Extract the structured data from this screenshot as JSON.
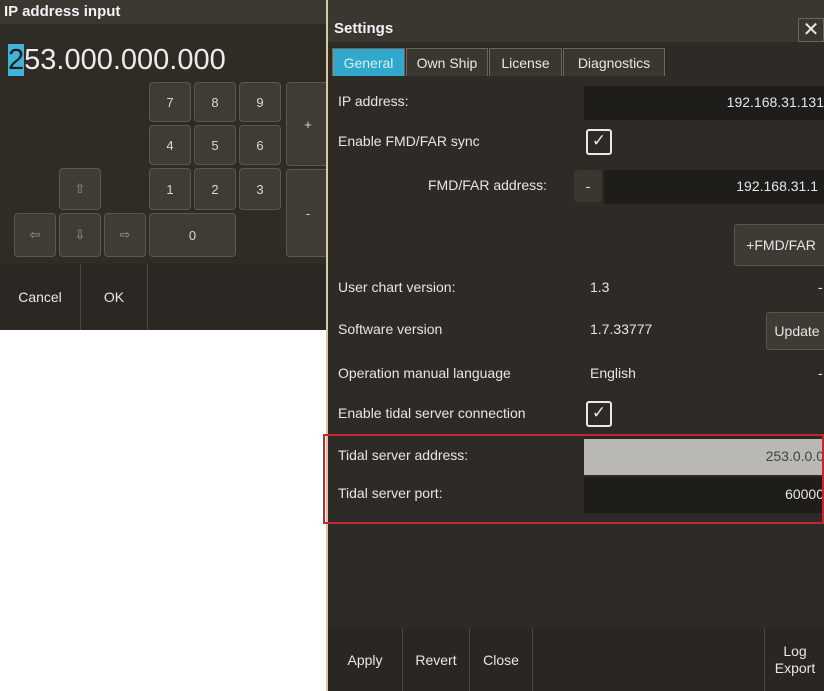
{
  "ip_dialog": {
    "title": "IP address input",
    "value_cursor": "2",
    "value_rest": "53.000.000.000",
    "keys": {
      "k7": "7",
      "k8": "8",
      "k9": "9",
      "k4": "4",
      "k5": "5",
      "k6": "6",
      "k1": "1",
      "k2": "2",
      "k3": "3",
      "k0": "0",
      "plus": "+",
      "minus": "-"
    },
    "arrows": {
      "up": "⇧",
      "down": "⇩",
      "left": "⇦",
      "right": "⇨"
    },
    "cancel_label": "Cancel",
    "ok_label": "OK"
  },
  "settings": {
    "title": "Settings",
    "close_glyph": "✕",
    "tabs": [
      "General",
      "Own Ship",
      "License",
      "Diagnostics"
    ],
    "active_tab": "General",
    "ip_address_label": "IP address:",
    "ip_address_value": "192.168.31.131",
    "fmd_sync_label": "Enable FMD/FAR sync",
    "fmd_sync_checked": "☑",
    "fmd_address_label": "FMD/FAR address:",
    "fmd_address_minus": "-",
    "fmd_address_value": "192.168.31.1",
    "add_fmd_label": "+FMD/FAR",
    "chart_version_label": "User chart version:",
    "chart_version_value": "1.3",
    "software_version_label": "Software version",
    "software_version_value": "1.7.33777",
    "update_label": "Update",
    "manual_language_label": "Operation manual language",
    "manual_language_value": "English",
    "tidal_enable_label": "Enable tidal server connection",
    "tidal_address_label": "Tidal server address:",
    "tidal_address_value": "253.0.0.0",
    "tidal_port_label": "Tidal server port:",
    "tidal_port_value": "60000",
    "apply_label": "Apply",
    "revert_label": "Revert",
    "close_label": "Close",
    "log_export_label_1": "Log",
    "log_export_label_2": "Export"
  },
  "colors": {
    "accent": "#2fa8cc",
    "highlight": "#c2262e",
    "panel_bg": "#2e2b26"
  }
}
